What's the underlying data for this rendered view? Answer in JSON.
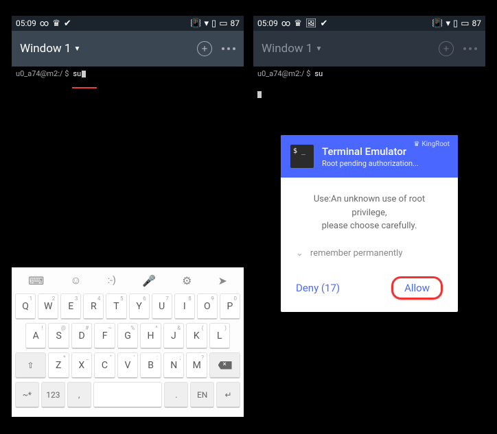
{
  "status": {
    "time": "05:09",
    "battery": "87",
    "icons_left": [
      "∞",
      "crown",
      "check"
    ],
    "icons_right": [
      "vibrate",
      "wifi",
      "signal",
      "battery"
    ],
    "icons_left_right_screen": [
      "∞",
      "crown",
      "picture",
      "check"
    ]
  },
  "titlebar": {
    "window_label": "Window 1"
  },
  "terminal": {
    "prompt": "u0_a74@m2:/ $",
    "command": "su"
  },
  "popup": {
    "brand": "KingRoot",
    "title": "Terminal Emulator",
    "subtitle": "Root pending authorization...",
    "body1": "Use:An unknown use of root privilege,",
    "body2": "please choose carefully.",
    "remember": "remember permanently",
    "deny": "Deny (17)",
    "allow": "Allow"
  },
  "keyboard": {
    "toolbar": [
      "keyboard",
      "emoji",
      "smiley",
      "mic",
      "gear",
      "arrow"
    ],
    "rows": [
      [
        {
          "k": "Q",
          "s": "1"
        },
        {
          "k": "W",
          "s": "2"
        },
        {
          "k": "E",
          "s": "3"
        },
        {
          "k": "R",
          "s": "4"
        },
        {
          "k": "T",
          "s": "5"
        },
        {
          "k": "Y",
          "s": "6"
        },
        {
          "k": "U",
          "s": "7"
        },
        {
          "k": "I",
          "s": "8"
        },
        {
          "k": "O",
          "s": "9"
        },
        {
          "k": "P",
          "s": "0"
        }
      ],
      [
        {
          "k": "A",
          "s": "!"
        },
        {
          "k": "S",
          "s": "@"
        },
        {
          "k": "D",
          "s": "#"
        },
        {
          "k": "F",
          "s": "~"
        },
        {
          "k": "G",
          "s": "%"
        },
        {
          "k": "H",
          "s": "^"
        },
        {
          "k": "J",
          "s": "&"
        },
        {
          "k": "K",
          "s": "("
        },
        {
          "k": "L",
          "s": ")"
        }
      ],
      [
        {
          "k": "⇧",
          "fn": true,
          "wide": true
        },
        {
          "k": "Z",
          "s": "*"
        },
        {
          "k": "X",
          "s": "_"
        },
        {
          "k": "C",
          "s": "\""
        },
        {
          "k": "V",
          "s": "'"
        },
        {
          "k": "B",
          "s": ":"
        },
        {
          "k": "N",
          "s": ";"
        },
        {
          "k": "M",
          "s": "?"
        },
        {
          "k": "back",
          "fn": true,
          "wide": true
        }
      ],
      [
        {
          "k": "~*",
          "fn": true
        },
        {
          "k": "123",
          "fn": true
        },
        {
          "k": ",",
          "fn": true
        },
        {
          "k": "",
          "space": true
        },
        {
          "k": ".",
          "fn": true
        },
        {
          "k": "EN",
          "fn": true
        },
        {
          "k": "↵",
          "fn": true
        }
      ]
    ]
  }
}
